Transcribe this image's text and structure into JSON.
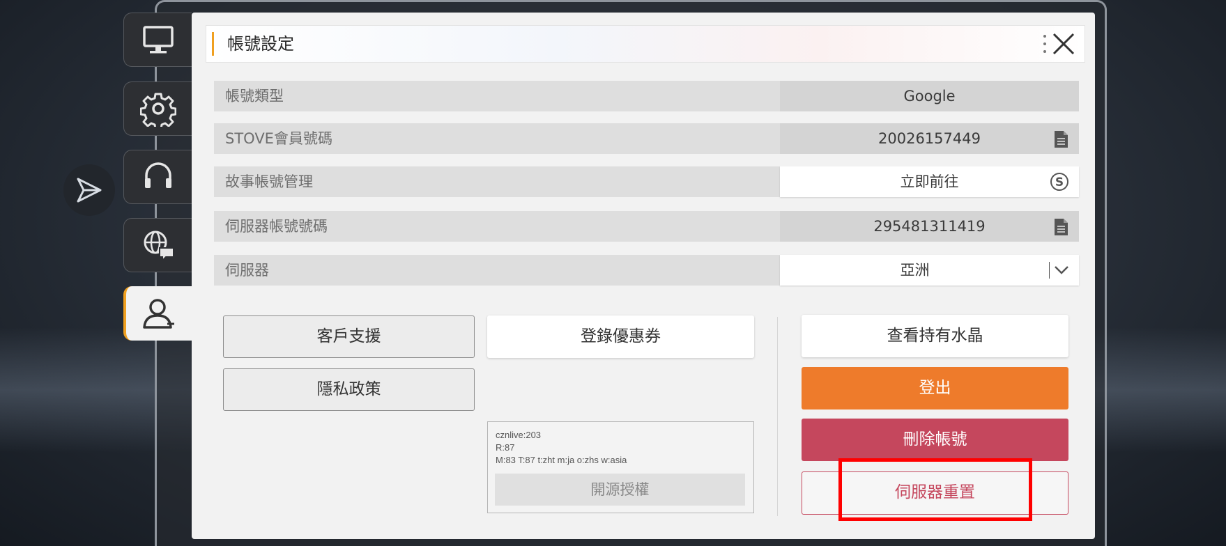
{
  "window": {
    "title": "帳號設定"
  },
  "colors": {
    "accent": "#f0a020",
    "logout": "#ee7b2b",
    "delete": "#c5475d",
    "highlight": "#ff0000"
  },
  "side_tabs": [
    {
      "icon": "monitor-icon",
      "active": false
    },
    {
      "icon": "gear-icon",
      "active": false
    },
    {
      "icon": "headset-icon",
      "active": false
    },
    {
      "icon": "globe-chat-icon",
      "active": false
    },
    {
      "icon": "user-icon",
      "active": true
    }
  ],
  "side_extra": {
    "icon": "send-icon"
  },
  "rows": [
    {
      "label": "帳號類型",
      "value": "Google"
    },
    {
      "label": "STOVE會員號碼",
      "value": "20026157449",
      "icon": "copy-icon"
    },
    {
      "label": "故事帳號管理",
      "value": "立即前往",
      "icon": "stove-icon"
    },
    {
      "label": "伺服器帳號號碼",
      "value": "295481311419",
      "icon": "copy-icon"
    },
    {
      "label": "伺服器",
      "value": "亞洲",
      "icon": "chevron-down-icon"
    }
  ],
  "buttons": {
    "customer_support": "客戶支援",
    "privacy_policy": "隱私政策",
    "register_coupon": "登錄優惠券",
    "view_crystals": "查看持有水晶",
    "logout": "登出",
    "delete_account": "刪除帳號",
    "server_reset": "伺服器重置"
  },
  "info": {
    "line1": "cznlive:203",
    "line2": "R:87",
    "line3": "M:83 T:87 t:zht m:ja o:zhs w:asia",
    "license_button": "開源授權"
  }
}
